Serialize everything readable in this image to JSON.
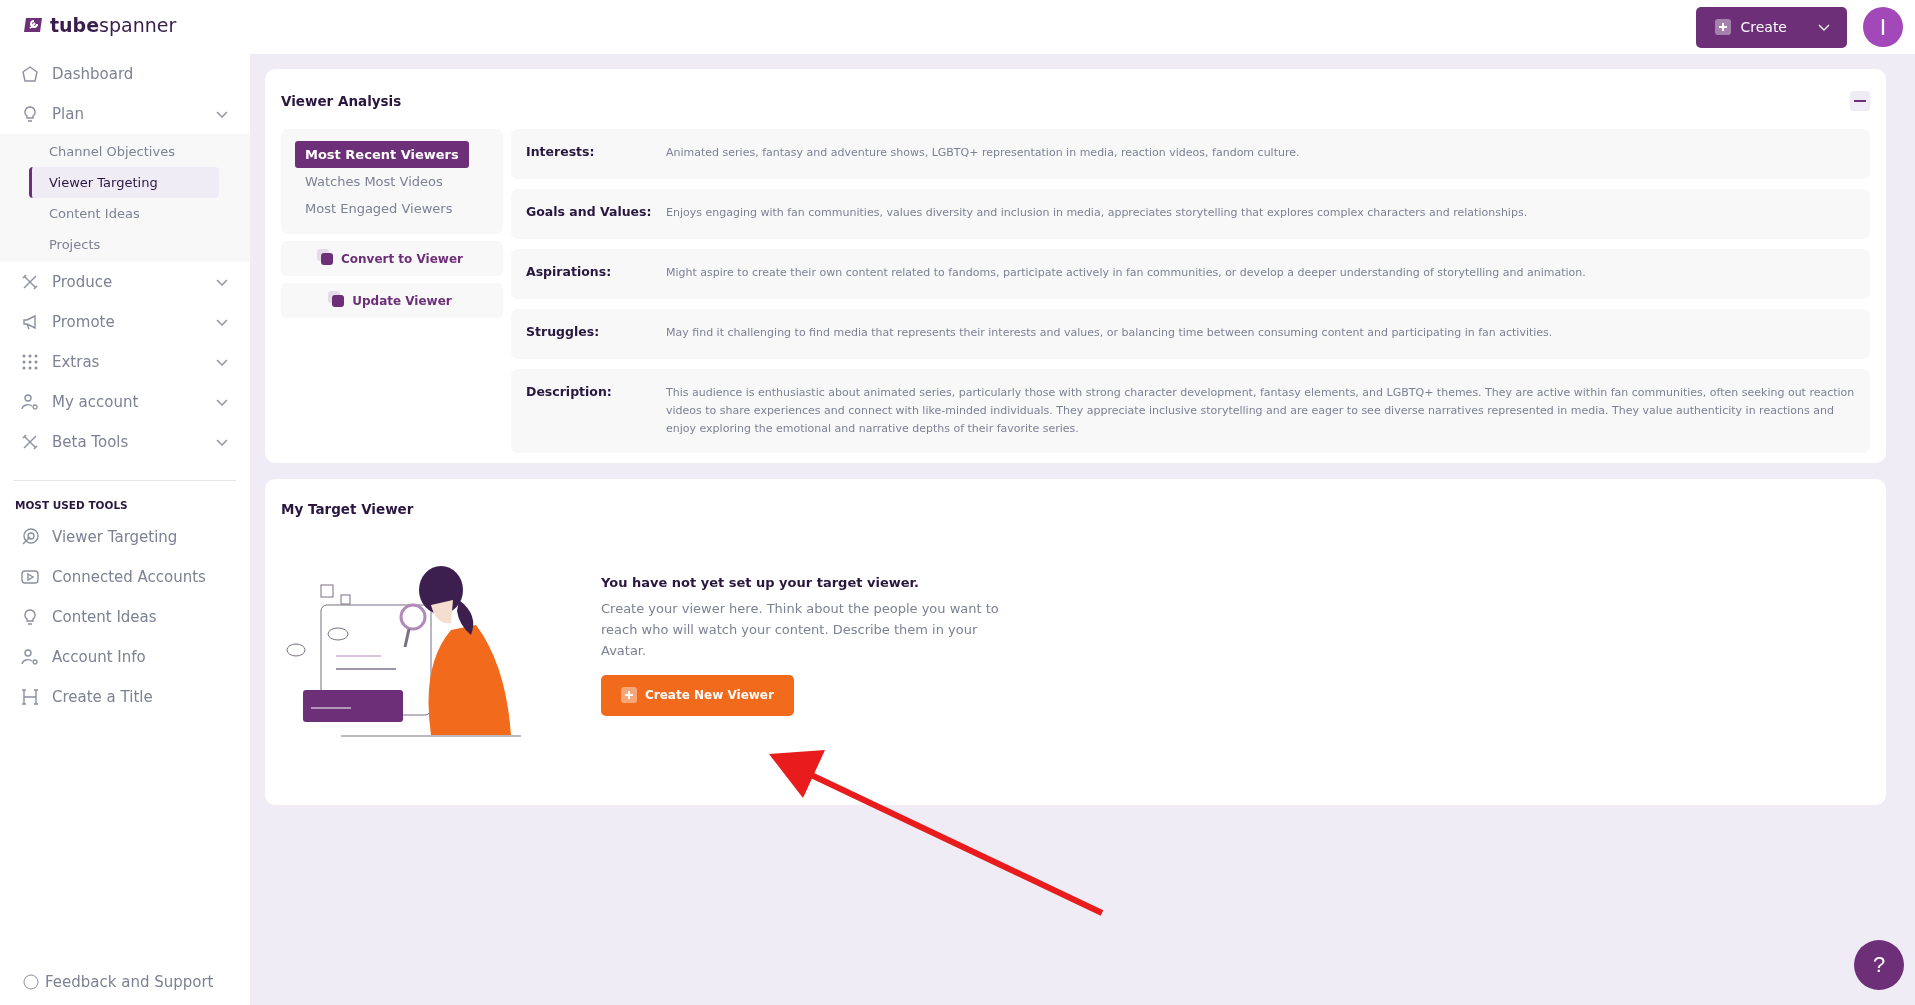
{
  "header": {
    "logo": "**tube**spanner",
    "create_button": "Create",
    "avatar": "I"
  },
  "sidebar": {
    "items": [
      {
        "label": "Dashboard",
        "kind": "link"
      },
      {
        "label": "Plan",
        "kind": "group",
        "children": [
          {
            "label": "Channel Objectives",
            "selected": false
          },
          {
            "label": "Viewer Targeting",
            "selected": true
          },
          {
            "label": "Content Ideas",
            "selected": false
          },
          {
            "label": "Projects",
            "selected": false
          }
        ]
      },
      {
        "label": "Produce",
        "kind": "group"
      },
      {
        "label": "Promote",
        "kind": "group"
      },
      {
        "label": "Extras",
        "kind": "group"
      },
      {
        "label": "My account",
        "kind": "group"
      },
      {
        "label": "Beta Tools",
        "kind": "group"
      }
    ],
    "section_title": "MOST USED TOOLS",
    "tools": [
      "Viewer Targeting",
      "Connected Accounts",
      "Content Ideas",
      "Account Info",
      "Create a Title"
    ],
    "footer": "Feedback and Support"
  },
  "viewer_analysis": {
    "title": "Viewer Analysis",
    "tabs": [
      {
        "label": "Most Recent Viewers",
        "selected": true
      },
      {
        "label": "Watches Most Videos",
        "selected": false
      },
      {
        "label": "Most Engaged Viewers",
        "selected": false
      }
    ],
    "actions": [
      "Convert to Viewer",
      "Update Viewer"
    ],
    "details": [
      {
        "label": "Interests:",
        "text": "Animated series, fantasy and adventure shows, LGBTQ+ representation in media, reaction videos, fandom culture."
      },
      {
        "label": "Goals and Values:",
        "text": "Enjoys engaging with fan communities, values diversity and inclusion in media, appreciates storytelling that explores complex characters and relationships."
      },
      {
        "label": "Aspirations:",
        "text": "Might aspire to create their own content related to fandoms, participate actively in fan communities, or develop a deeper understanding of storytelling and animation."
      },
      {
        "label": "Struggles:",
        "text": "May find it challenging to find media that represents their interests and values, or balancing time between consuming content and participating in fan activities."
      },
      {
        "label": "Description:",
        "text": "This audience is enthusiastic about animated series, particularly those with strong character development, fantasy elements, and LGBTQ+ themes. They are active within fan communities, often seeking out reaction videos to share experiences and connect with like-minded individuals. They appreciate inclusive storytelling and are eager to see diverse narratives represented in media. They value authenticity in reactions and enjoy exploring the emotional and narrative depths of their favorite series."
      }
    ]
  },
  "target_viewer": {
    "title": "My Target Viewer",
    "heading": "You have not yet set up your target viewer.",
    "text": "Create your viewer here. Think about the people you want to reach who will watch your content. Describe them in your Avatar.",
    "button": "Create New Viewer"
  },
  "help_button": "?"
}
